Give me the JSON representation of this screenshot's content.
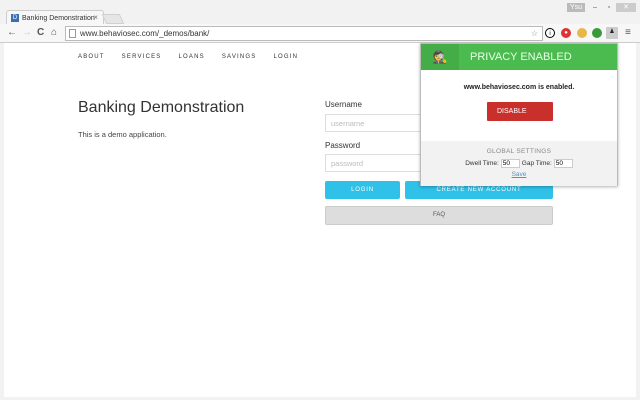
{
  "browser": {
    "tab_title": "Banking Demonstration",
    "tab_favicon": "D",
    "url": "www.behaviosec.com/_demos/bank/",
    "window_user": "Ysu"
  },
  "nav": [
    "ABOUT",
    "SERVICES",
    "LOANS",
    "SAVINGS",
    "LOGIN"
  ],
  "main": {
    "title": "Banking Demonstration",
    "description": "This is a demo application."
  },
  "login": {
    "username_label": "Username",
    "username_placeholder": "username",
    "password_label": "Password",
    "password_placeholder": "password",
    "login_button": "LOGIN",
    "create_button": "CREATE NEW ACCOUNT",
    "faq_button": "FAQ"
  },
  "popup": {
    "header": "PRIVACY ENABLED",
    "status": "www.behaviosec.com is enabled.",
    "disable_button": "DISABLE",
    "global_settings": "GLOBAL SETTINGS",
    "dwell_label": "Dwell Time:",
    "dwell_value": "50",
    "gap_label": "Gap Time:",
    "gap_value": "50",
    "save_link": "Save"
  },
  "colors": {
    "green": "#4cbb4f",
    "red": "#c9302c",
    "blue": "#2fc1e8"
  }
}
